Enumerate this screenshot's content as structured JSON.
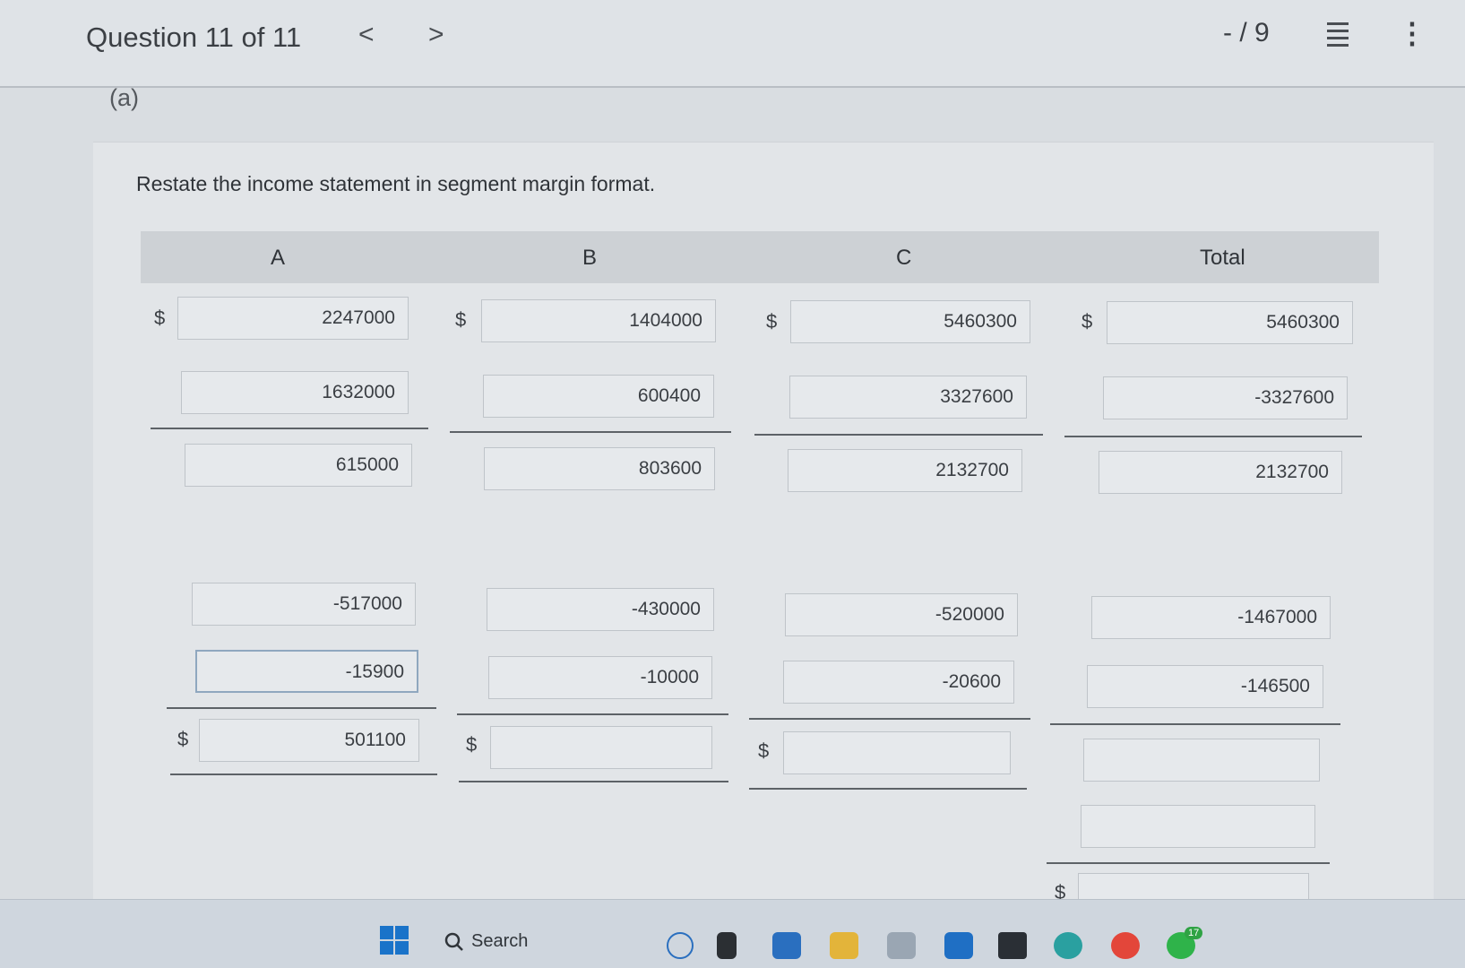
{
  "header": {
    "question_label": "Question 11 of 11",
    "prev_arrow": "<",
    "next_arrow": ">",
    "score": "- / 9"
  },
  "part": {
    "label": "(a)"
  },
  "instruction": "Restate the income statement in segment margin format.",
  "columns": [
    "A",
    "B",
    "C",
    "Total"
  ],
  "currency_symbol": "$",
  "rows": {
    "r1": [
      "2247000",
      "1404000",
      "5460300",
      "5460300"
    ],
    "r2": [
      "1632000",
      "600400",
      "3327600",
      "-3327600"
    ],
    "r3": [
      "615000",
      "803600",
      "2132700",
      "2132700"
    ],
    "r4": [
      "-517000",
      "-430000",
      "-520000",
      "-1467000"
    ],
    "r5": [
      "-15900",
      "-10000",
      "-20600",
      "-146500"
    ],
    "r6": [
      "501100",
      "",
      "",
      ""
    ],
    "r7_total": "",
    "r8_total": ""
  },
  "taskbar": {
    "search_label": "Search",
    "icons": [
      "windows-start-icon",
      "search-icon",
      "chat-icon",
      "terminal-icon",
      "teams-icon",
      "file-explorer-icon",
      "calendar-icon",
      "store-icon",
      "dropbox-icon",
      "edge-icon",
      "chrome-icon",
      "whatsapp-icon"
    ],
    "badge_count": "17"
  },
  "colors": {
    "background": "#d9dde1",
    "panel": "#e2e5e8",
    "header_row": "#cdd1d5",
    "field_border": "#bfc4c9",
    "accent_blue": "#1a73c9"
  }
}
